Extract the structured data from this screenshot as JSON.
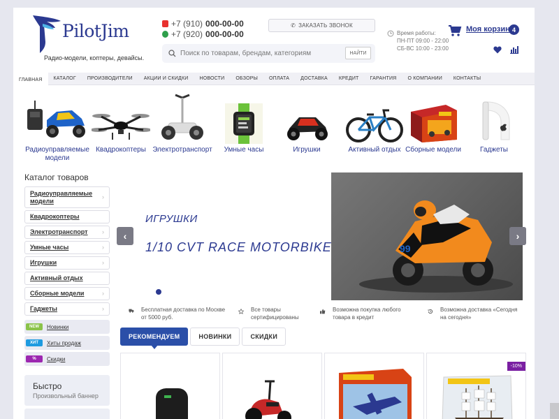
{
  "header": {
    "logo_text": "PilotJim",
    "tagline": "Радио-модели, коптеры, девайсы.",
    "phones": [
      {
        "prefix": "+7 (910)",
        "number": "000-00-00",
        "operator": "mts",
        "color": "#e8312f"
      },
      {
        "prefix": "+7 (920)",
        "number": "000-00-00",
        "operator": "megafon",
        "color": "#2e9f4b"
      }
    ],
    "callback_button": "ЗАКАЗАТЬ ЗВОНОК",
    "hours_title": "Время работы:",
    "hours_line1": "ПН-ПТ 09:00 - 22:00",
    "hours_line2": "СБ-ВС 10:00 - 23:00",
    "cart_label": "Моя корзина",
    "cart_count": "4",
    "search_placeholder": "Поиск по товарам, брендам, категориям",
    "search_button": "НАЙТИ"
  },
  "nav": [
    "ГЛАВНАЯ",
    "КАТАЛОГ",
    "ПРОИЗВОДИТЕЛИ",
    "АКЦИИ И СКИДКИ",
    "НОВОСТИ",
    "ОБЗОРЫ",
    "ОПЛАТА",
    "ДОСТАВКА",
    "КРЕДИТ",
    "ГАРАНТИЯ",
    "О КОМПАНИИ",
    "КОНТАКТЫ"
  ],
  "categories": [
    {
      "label": "Радиоуправляемые модели",
      "icon": "rc-car-image"
    },
    {
      "label": "Квадрокоптеры",
      "icon": "quadcopter-image"
    },
    {
      "label": "Электротранспорт",
      "icon": "segway-image"
    },
    {
      "label": "Умные часы",
      "icon": "smartwatch-image"
    },
    {
      "label": "Игрушки",
      "icon": "toy-buggy-image"
    },
    {
      "label": "Активный отдых",
      "icon": "bicycle-image"
    },
    {
      "label": "Сборные модели",
      "icon": "model-kit-image"
    },
    {
      "label": "Гаджеты",
      "icon": "gadget-image"
    }
  ],
  "sidebar": {
    "title": "Каталог товаров",
    "items": [
      "Радиоуправляемые модели",
      "Квадрокоптеры",
      "Электротранспорт",
      "Умные часы",
      "Игрушки",
      "Активный отдых",
      "Сборные модели",
      "Гаджеты"
    ],
    "tags": [
      {
        "badge": "NEW",
        "label": "Новинки",
        "color": "#8bc34a"
      },
      {
        "badge": "ХИТ",
        "label": "Хиты продаж",
        "color": "#1e9be0"
      },
      {
        "badge": "%",
        "label": "Скидки",
        "color": "#9c27b0"
      }
    ],
    "banner_title": "Быстро",
    "banner_subtitle": "Произвольный баннер"
  },
  "slider": {
    "category": "ИГРУШКИ",
    "title": "1/10 CVT RACE MOTORBIKE"
  },
  "features": [
    {
      "icon": "truck-icon",
      "text": "Бесплатная доставка по Москве от 5000 руб."
    },
    {
      "icon": "star-icon",
      "text": "Все товары сертифицированы"
    },
    {
      "icon": "thumbs-up-icon",
      "text": "Возможна покупка любого товара в кредит"
    },
    {
      "icon": "history-icon",
      "text": "Возможна доставка «Сегодня на сегодня»"
    }
  ],
  "tabs": [
    "РЕКОМЕНДУЕМ",
    "НОВИНКИ",
    "СКИДКИ"
  ],
  "products": [
    {
      "image": "gadget-device"
    },
    {
      "image": "electric-scooter"
    },
    {
      "image": "airplane-model-kit"
    },
    {
      "image": "ship-model-kit",
      "discount": "-10%"
    }
  ],
  "colors": {
    "brand": "#2b3990",
    "tab_active": "#2b4fa8",
    "background": "#e6e7ef"
  }
}
